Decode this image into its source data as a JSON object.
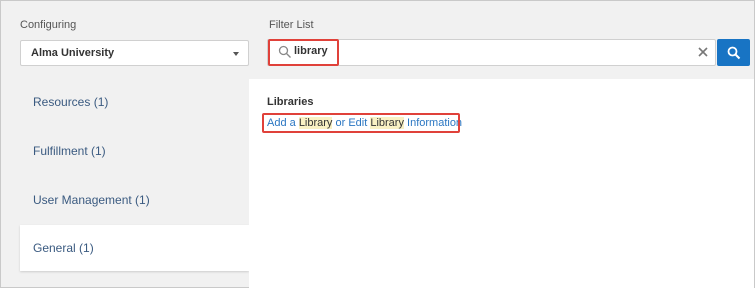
{
  "configuring": {
    "label": "Configuring",
    "selected": "Alma University"
  },
  "filter": {
    "label": "Filter List",
    "value": "library"
  },
  "nav": {
    "items": [
      {
        "label": "Resources (1)"
      },
      {
        "label": "Fulfillment (1)"
      },
      {
        "label": "User Management (1)"
      },
      {
        "label": "General (1)"
      }
    ],
    "active_index": 3
  },
  "results": {
    "section_title": "Libraries",
    "link": {
      "part1": "Add a ",
      "part2": "Library",
      "part3": " or Edit ",
      "part4": "Library",
      "part5": " Information"
    }
  },
  "icons": {
    "search": "search-icon",
    "clear": "close-icon",
    "caret": "chevron-down-icon"
  },
  "colors": {
    "accent": "#1874c4",
    "highlight_border": "#e0413a",
    "match_highlight": "#f9f1c4",
    "link": "#2a76c2"
  }
}
